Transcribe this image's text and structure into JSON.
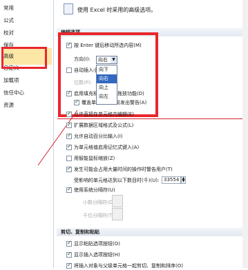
{
  "sidebar": {
    "items": [
      {
        "label": "常用"
      },
      {
        "label": "公式"
      },
      {
        "label": "校对"
      },
      {
        "label": "保存"
      },
      {
        "label": "高级"
      },
      {
        "label": "自定义"
      },
      {
        "label": "加载项"
      },
      {
        "label": "信任中心"
      },
      {
        "label": "资源"
      }
    ]
  },
  "header": {
    "title": "使用 Excel 时采用的高级选项。"
  },
  "sections": {
    "edit_options": "编辑选项",
    "cut_copy_paste": "剪切、复制和粘贴"
  },
  "edit": {
    "move_after_enter": "按 Enter 键后移动所选内容(M)",
    "direction_label": "方向(I):",
    "direction_value": "向右",
    "direction_options": [
      "向下",
      "向右",
      "向上",
      "向左"
    ],
    "direction_selected_index": 1,
    "auto_decimal": "自动插入小数点(D)",
    "places_label": "位数(P):",
    "fill_handle": "启用填充柄和单元格拖放功能(D)",
    "overwrite_alert": "覆盖单元格内容前发出警告(A)",
    "direct_edit": "允许直接在单元格内编辑(E)",
    "extend_formats": "扩展数据区域格式及公式(L)",
    "auto_percent": "允许自动百分比输入(I)",
    "autocomplete": "为单元格值启用记忆式键入(A)",
    "intellimouse": "用智能鼠标缩放(Z)",
    "slow_alert": "发生可能会占用大量时间的操作时警告用户(T)",
    "affected_cells_label": "受影响的单元格达到以下数目时(千)(U):",
    "affected_cells_value": "33554",
    "system_separators": "使用系统分隔符(U)",
    "decimal_sep_label": "小数分隔符(D):",
    "thousands_sep_label": "千位分隔符(T):"
  },
  "paste": {
    "show_paste_options": "显示粘贴选项按钮(O)",
    "show_insert_options": "显示插入选项按钮(H)",
    "cut_copy_sort": "将插入对象与父级单元格一起剪切、复制和排序(O)"
  },
  "colors": {
    "highlight": "#fde7a7",
    "annotation": "#e8262b",
    "selection": "#3468c0"
  }
}
